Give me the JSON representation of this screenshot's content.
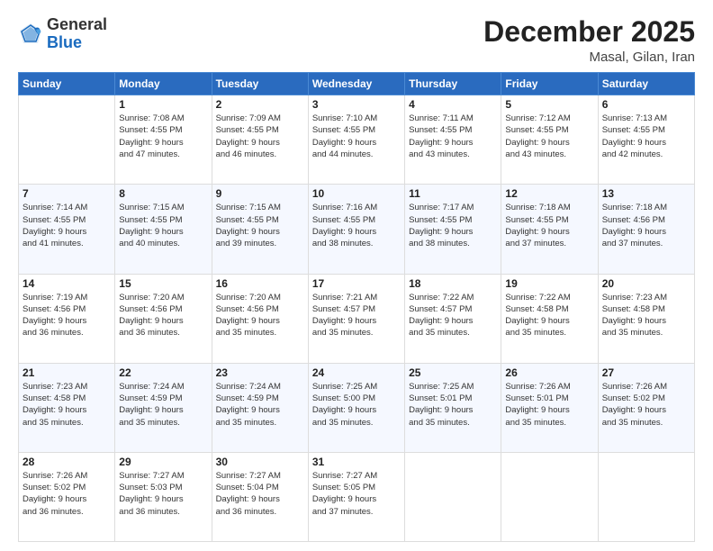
{
  "logo": {
    "general": "General",
    "blue": "Blue"
  },
  "header": {
    "month": "December 2025",
    "location": "Masal, Gilan, Iran"
  },
  "weekdays": [
    "Sunday",
    "Monday",
    "Tuesday",
    "Wednesday",
    "Thursday",
    "Friday",
    "Saturday"
  ],
  "weeks": [
    [
      {
        "day": "",
        "info": ""
      },
      {
        "day": "1",
        "info": "Sunrise: 7:08 AM\nSunset: 4:55 PM\nDaylight: 9 hours\nand 47 minutes."
      },
      {
        "day": "2",
        "info": "Sunrise: 7:09 AM\nSunset: 4:55 PM\nDaylight: 9 hours\nand 46 minutes."
      },
      {
        "day": "3",
        "info": "Sunrise: 7:10 AM\nSunset: 4:55 PM\nDaylight: 9 hours\nand 44 minutes."
      },
      {
        "day": "4",
        "info": "Sunrise: 7:11 AM\nSunset: 4:55 PM\nDaylight: 9 hours\nand 43 minutes."
      },
      {
        "day": "5",
        "info": "Sunrise: 7:12 AM\nSunset: 4:55 PM\nDaylight: 9 hours\nand 43 minutes."
      },
      {
        "day": "6",
        "info": "Sunrise: 7:13 AM\nSunset: 4:55 PM\nDaylight: 9 hours\nand 42 minutes."
      }
    ],
    [
      {
        "day": "7",
        "info": "Sunrise: 7:14 AM\nSunset: 4:55 PM\nDaylight: 9 hours\nand 41 minutes."
      },
      {
        "day": "8",
        "info": "Sunrise: 7:15 AM\nSunset: 4:55 PM\nDaylight: 9 hours\nand 40 minutes."
      },
      {
        "day": "9",
        "info": "Sunrise: 7:15 AM\nSunset: 4:55 PM\nDaylight: 9 hours\nand 39 minutes."
      },
      {
        "day": "10",
        "info": "Sunrise: 7:16 AM\nSunset: 4:55 PM\nDaylight: 9 hours\nand 38 minutes."
      },
      {
        "day": "11",
        "info": "Sunrise: 7:17 AM\nSunset: 4:55 PM\nDaylight: 9 hours\nand 38 minutes."
      },
      {
        "day": "12",
        "info": "Sunrise: 7:18 AM\nSunset: 4:55 PM\nDaylight: 9 hours\nand 37 minutes."
      },
      {
        "day": "13",
        "info": "Sunrise: 7:18 AM\nSunset: 4:56 PM\nDaylight: 9 hours\nand 37 minutes."
      }
    ],
    [
      {
        "day": "14",
        "info": "Sunrise: 7:19 AM\nSunset: 4:56 PM\nDaylight: 9 hours\nand 36 minutes."
      },
      {
        "day": "15",
        "info": "Sunrise: 7:20 AM\nSunset: 4:56 PM\nDaylight: 9 hours\nand 36 minutes."
      },
      {
        "day": "16",
        "info": "Sunrise: 7:20 AM\nSunset: 4:56 PM\nDaylight: 9 hours\nand 35 minutes."
      },
      {
        "day": "17",
        "info": "Sunrise: 7:21 AM\nSunset: 4:57 PM\nDaylight: 9 hours\nand 35 minutes."
      },
      {
        "day": "18",
        "info": "Sunrise: 7:22 AM\nSunset: 4:57 PM\nDaylight: 9 hours\nand 35 minutes."
      },
      {
        "day": "19",
        "info": "Sunrise: 7:22 AM\nSunset: 4:58 PM\nDaylight: 9 hours\nand 35 minutes."
      },
      {
        "day": "20",
        "info": "Sunrise: 7:23 AM\nSunset: 4:58 PM\nDaylight: 9 hours\nand 35 minutes."
      }
    ],
    [
      {
        "day": "21",
        "info": "Sunrise: 7:23 AM\nSunset: 4:58 PM\nDaylight: 9 hours\nand 35 minutes."
      },
      {
        "day": "22",
        "info": "Sunrise: 7:24 AM\nSunset: 4:59 PM\nDaylight: 9 hours\nand 35 minutes."
      },
      {
        "day": "23",
        "info": "Sunrise: 7:24 AM\nSunset: 4:59 PM\nDaylight: 9 hours\nand 35 minutes."
      },
      {
        "day": "24",
        "info": "Sunrise: 7:25 AM\nSunset: 5:00 PM\nDaylight: 9 hours\nand 35 minutes."
      },
      {
        "day": "25",
        "info": "Sunrise: 7:25 AM\nSunset: 5:01 PM\nDaylight: 9 hours\nand 35 minutes."
      },
      {
        "day": "26",
        "info": "Sunrise: 7:26 AM\nSunset: 5:01 PM\nDaylight: 9 hours\nand 35 minutes."
      },
      {
        "day": "27",
        "info": "Sunrise: 7:26 AM\nSunset: 5:02 PM\nDaylight: 9 hours\nand 35 minutes."
      }
    ],
    [
      {
        "day": "28",
        "info": "Sunrise: 7:26 AM\nSunset: 5:02 PM\nDaylight: 9 hours\nand 36 minutes."
      },
      {
        "day": "29",
        "info": "Sunrise: 7:27 AM\nSunset: 5:03 PM\nDaylight: 9 hours\nand 36 minutes."
      },
      {
        "day": "30",
        "info": "Sunrise: 7:27 AM\nSunset: 5:04 PM\nDaylight: 9 hours\nand 36 minutes."
      },
      {
        "day": "31",
        "info": "Sunrise: 7:27 AM\nSunset: 5:05 PM\nDaylight: 9 hours\nand 37 minutes."
      },
      {
        "day": "",
        "info": ""
      },
      {
        "day": "",
        "info": ""
      },
      {
        "day": "",
        "info": ""
      }
    ]
  ]
}
